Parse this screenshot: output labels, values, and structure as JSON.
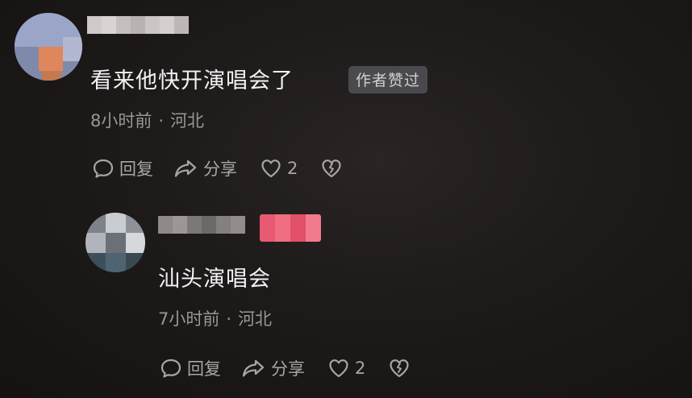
{
  "comments": [
    {
      "text": "看来他快开演唱会了",
      "author_badge": "作者赞过",
      "time": "8小时前",
      "separator": "·",
      "location": "河北",
      "actions": {
        "reply": "回复",
        "share": "分享",
        "like_count": "2"
      }
    },
    {
      "text": "汕头演唱会",
      "time": "7小时前",
      "separator": "·",
      "location": "河北",
      "actions": {
        "reply": "回复",
        "share": "分享",
        "like_count": "2"
      }
    }
  ],
  "icons": {
    "reply": "comment-bubble-icon",
    "share": "share-arrow-icon",
    "like": "heart-icon",
    "dislike": "broken-heart-icon"
  },
  "colors": {
    "background": "#1e1a1a",
    "text": "#f2f2f2",
    "meta": "#9a9696",
    "badge_bg": "#4a4a4e",
    "badge_text": "#cfcfd2",
    "pink_badge": "#e8506a"
  }
}
